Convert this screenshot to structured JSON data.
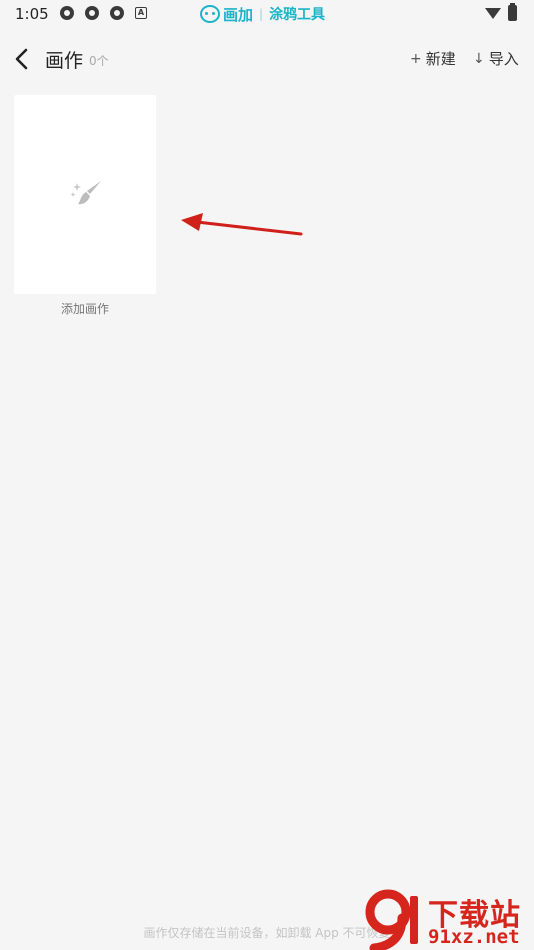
{
  "status_bar": {
    "time": "1:05",
    "app_icons": [
      "chrome-like-icon",
      "chrome-like-icon",
      "chrome-like-icon"
    ],
    "a_icon_label": "A",
    "brand_name": "画加",
    "brand_tagline": "涂鸦工具"
  },
  "header": {
    "title": "画作",
    "count": "0个",
    "new_icon": "+",
    "new_label": "新建",
    "import_icon": "↓",
    "import_label": "导入"
  },
  "gallery": {
    "add_label": "添加画作"
  },
  "footer": {
    "note": "画作仅存储在当前设备，如卸载 App 不可恢复"
  },
  "watermark": {
    "brand": "下载站",
    "domain": "91xz.net"
  },
  "colors": {
    "accent": "#1cb4c9",
    "annotation_arrow": "#d0201a",
    "watermark": "#d6251d",
    "background": "#f5f5f5"
  }
}
